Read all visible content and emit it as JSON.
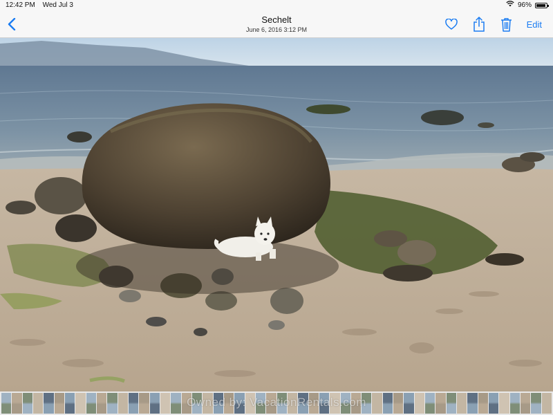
{
  "status_bar": {
    "time": "12:42 PM",
    "date": "Wed Jul 3",
    "battery_pct": "96%",
    "battery_level": 0.96,
    "wifi_icon": "wifi-icon"
  },
  "nav": {
    "title": "Sechelt",
    "subtitle": "June 6, 2016  3:12 PM",
    "edit_label": "Edit",
    "accent": "#1a7cf2"
  },
  "icons": [
    "back-chevron-icon",
    "heart-icon",
    "share-icon",
    "trash-icon"
  ],
  "watermark": "Owned by: VacationRentals.com"
}
